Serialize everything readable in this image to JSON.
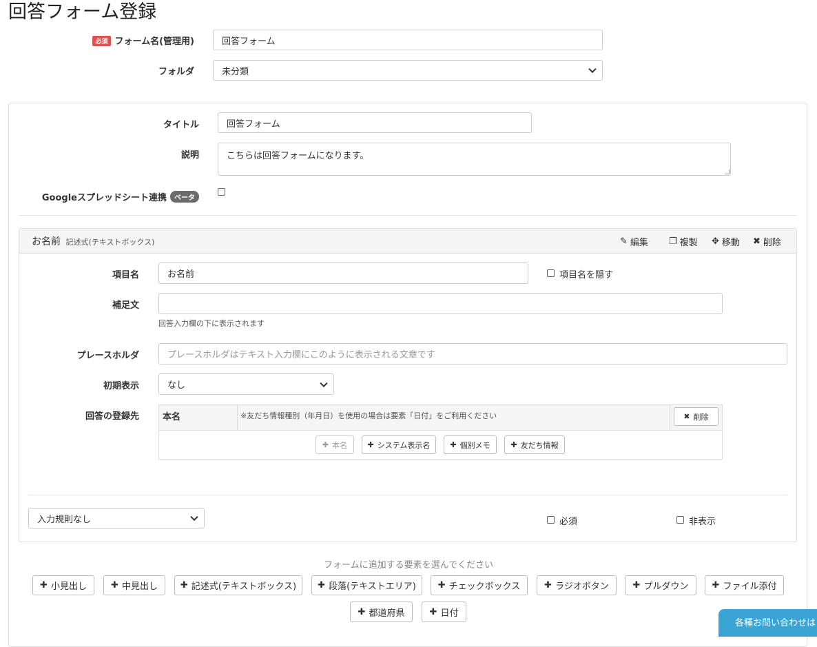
{
  "page": {
    "title": "回答フォーム登録"
  },
  "form_settings": {
    "name_label": "フォーム名(管理用)",
    "required_badge": "必須",
    "name_value": "回答フォーム",
    "folder_label": "フォルダ",
    "folder_value": "未分類"
  },
  "panel": {
    "title_label": "タイトル",
    "title_value": "回答フォーム",
    "desc_label": "説明",
    "desc_value": "こちらは回答フォームになります。",
    "google_label": "Googleスプレッドシート連携",
    "beta_badge": "ベータ"
  },
  "item": {
    "header_title": "お名前",
    "header_type": "記述式(テキストボックス)",
    "actions": {
      "edit": "編集",
      "copy": "複製",
      "move": "移動",
      "delete": "削除"
    },
    "name_label": "項目名",
    "name_value": "お名前",
    "hide_label": "項目名を隠す",
    "supplement_label": "補足文",
    "supplement_value": "",
    "supplement_note": "回答入力欄の下に表示されます",
    "placeholder_label": "プレースホルダ",
    "placeholder_hint": "プレースホルダはテキスト入力欄にこのように表示される文章です",
    "initial_label": "初期表示",
    "initial_value": "なし",
    "dest_label": "回答の登録先",
    "dest_table": {
      "col1": "本名",
      "note": "※友だち情報種別（年月日）を使用の場合は要素「日付」をご利用ください",
      "delete": "削除"
    },
    "dest_buttons": [
      "本名",
      "システム表示名",
      "個別メモ",
      "友だち情報"
    ],
    "rule_value": "入力規則なし",
    "required_label": "必須",
    "hidden_label": "非表示"
  },
  "add": {
    "hint": "フォームに追加する要素を選んでください",
    "buttons": [
      "小見出し",
      "中見出し",
      "記述式(テキストボックス)",
      "段落(テキストエリア)",
      "チェックボックス",
      "ラジオボタン",
      "プルダウン",
      "ファイル添付",
      "都道府県",
      "日付"
    ]
  },
  "contact": {
    "label": "各種お問い合わせはこちら"
  }
}
